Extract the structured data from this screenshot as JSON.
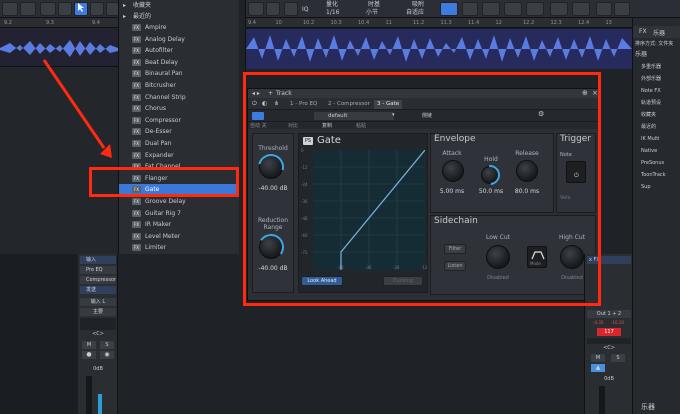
{
  "toolbar": {
    "iq": "IQ",
    "quantize_label": "量化",
    "quantize_value": "1/16",
    "timebase_label": "时基",
    "timebase_value": "小节",
    "snap_label": "吸附",
    "snap_value": "自适应"
  },
  "browser": {
    "favorites": "收藏夹",
    "recent": "最近的",
    "fx_badge": "FX",
    "items": [
      "Ampire",
      "Analog Delay",
      "Autofilter",
      "Beat Delay",
      "Binaural Pan",
      "Bitcrusher",
      "Channel Strip",
      "Chorus",
      "Compressor",
      "De-Esser",
      "Dual Pan",
      "Expander",
      "Fat Channel",
      "Flanger",
      "Gate",
      "Groove Delay",
      "Guitar Rig 7",
      "IR Maker",
      "Level Meter",
      "Limiter"
    ],
    "selected": "Gate"
  },
  "ruler": {
    "left_ticks": [
      "9.2",
      "9.3",
      "9.4"
    ],
    "right_ticks": [
      "9.4",
      "10",
      "10.2",
      "10.3",
      "10.4",
      "11",
      "11.2",
      "11.3",
      "11.4",
      "12",
      "12.2",
      "12.3",
      "12.4",
      "13"
    ]
  },
  "plugin": {
    "window_title": "Track",
    "tabs": [
      "1 - Pro EQ",
      "2 - Compressor",
      "3 - Gate"
    ],
    "active_tab": "3 - Gate",
    "preset": "default",
    "bar_labels": [
      "自动 关",
      "对比",
      "复制",
      "粘贴"
    ],
    "device_label": "侧链",
    "name": "Gate",
    "threshold_label": "Threshold",
    "threshold_value": "-40.00 dB",
    "range_label": "Reduction Range",
    "range_value": "-40.00 dB",
    "graph_y": [
      "0",
      "-12",
      "-24",
      "-36",
      "-48",
      "-60",
      "-72"
    ],
    "graph_x": [
      "-48",
      "-36",
      "-24",
      "-12"
    ],
    "look_ahead": "Look Ahead",
    "ducking": "Ducking",
    "envelope_title": "Envelope",
    "attack_label": "Attack",
    "attack_value": "5.00 ms",
    "hold_label": "Hold",
    "hold_value": "50.0 ms",
    "release_label": "Release",
    "release_value": "80.0 ms",
    "trigger_title": "Trigger",
    "trigger_note": "Note",
    "trigger_velo": "Velo",
    "sidechain_title": "Sidechain",
    "filter_btn": "Filter",
    "listen_btn": "Listen",
    "lowcut_label": "Low Cut",
    "lowcut_value": "Disabled",
    "highcut_label": "High Cut",
    "highcut_value": "Disabled",
    "mode_btn": "Mode"
  },
  "right_panel": {
    "tabs": [
      "FX",
      "乐器"
    ],
    "sort": "排序方式:",
    "sort_val": "文件夹",
    "instrument": "乐器",
    "items": [
      "多重乐器",
      "外部乐器",
      "Note FX",
      "轨道预设",
      "收藏夹",
      "最近的",
      "IK Multi",
      "Native",
      "PreSonus",
      "ToonTrack",
      "Sup"
    ],
    "bottom_label": "乐器"
  },
  "mixer_left": {
    "input": "输入",
    "inserts": [
      "Pro EQ",
      "Compressor"
    ],
    "send": "发送",
    "input_l": "输入 L",
    "main": "主要",
    "center": "<C>",
    "m": "M",
    "s": "S",
    "db": "0dB"
  },
  "mixer_right": {
    "fx": "x FX",
    "out": "Out 1 + 2",
    "level_a": "-4.35",
    "level_b": "-10.10",
    "track_no": "117",
    "center": "<C>",
    "m": "M",
    "s": "S",
    "db": "0dB"
  }
}
